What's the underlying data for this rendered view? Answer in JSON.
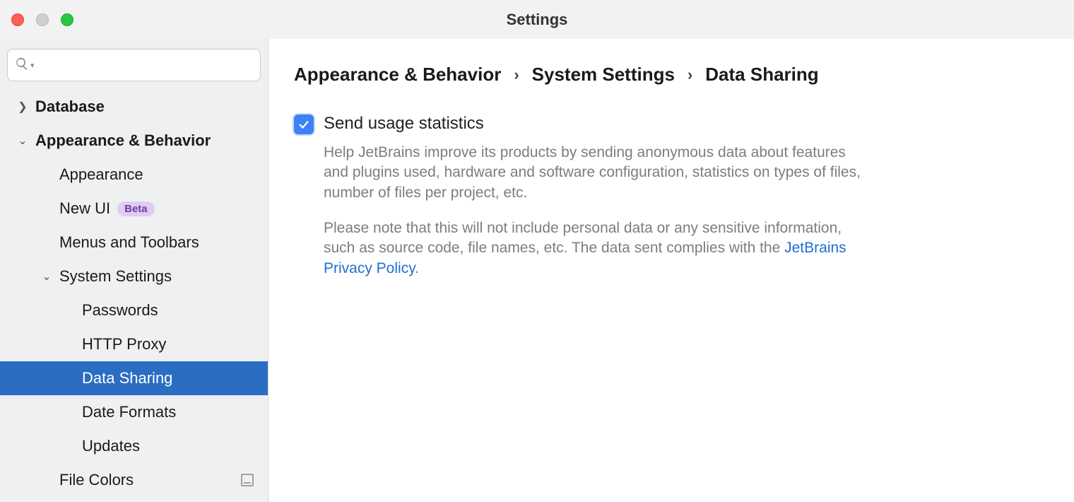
{
  "window": {
    "title": "Settings"
  },
  "search": {
    "placeholder": ""
  },
  "tree": {
    "database": "Database",
    "appearance_behavior": "Appearance & Behavior",
    "appearance": "Appearance",
    "new_ui": "New UI",
    "new_ui_badge": "Beta",
    "menus_toolbars": "Menus and Toolbars",
    "system_settings": "System Settings",
    "passwords": "Passwords",
    "http_proxy": "HTTP Proxy",
    "data_sharing": "Data Sharing",
    "date_formats": "Date Formats",
    "updates": "Updates",
    "file_colors": "File Colors"
  },
  "breadcrumb": {
    "a": "Appearance & Behavior",
    "b": "System Settings",
    "c": "Data Sharing"
  },
  "option": {
    "label": "Send usage statistics",
    "checked": true,
    "p1": "Help JetBrains improve its products by sending anonymous data about features and plugins used, hardware and software configuration, statistics on types of files, number of files per project, etc.",
    "p2a": "Please note that this will not include personal data or any sensitive information, such as source code, file names, etc. The data sent complies with the ",
    "link": "JetBrains Privacy Policy",
    "p2b": "."
  }
}
